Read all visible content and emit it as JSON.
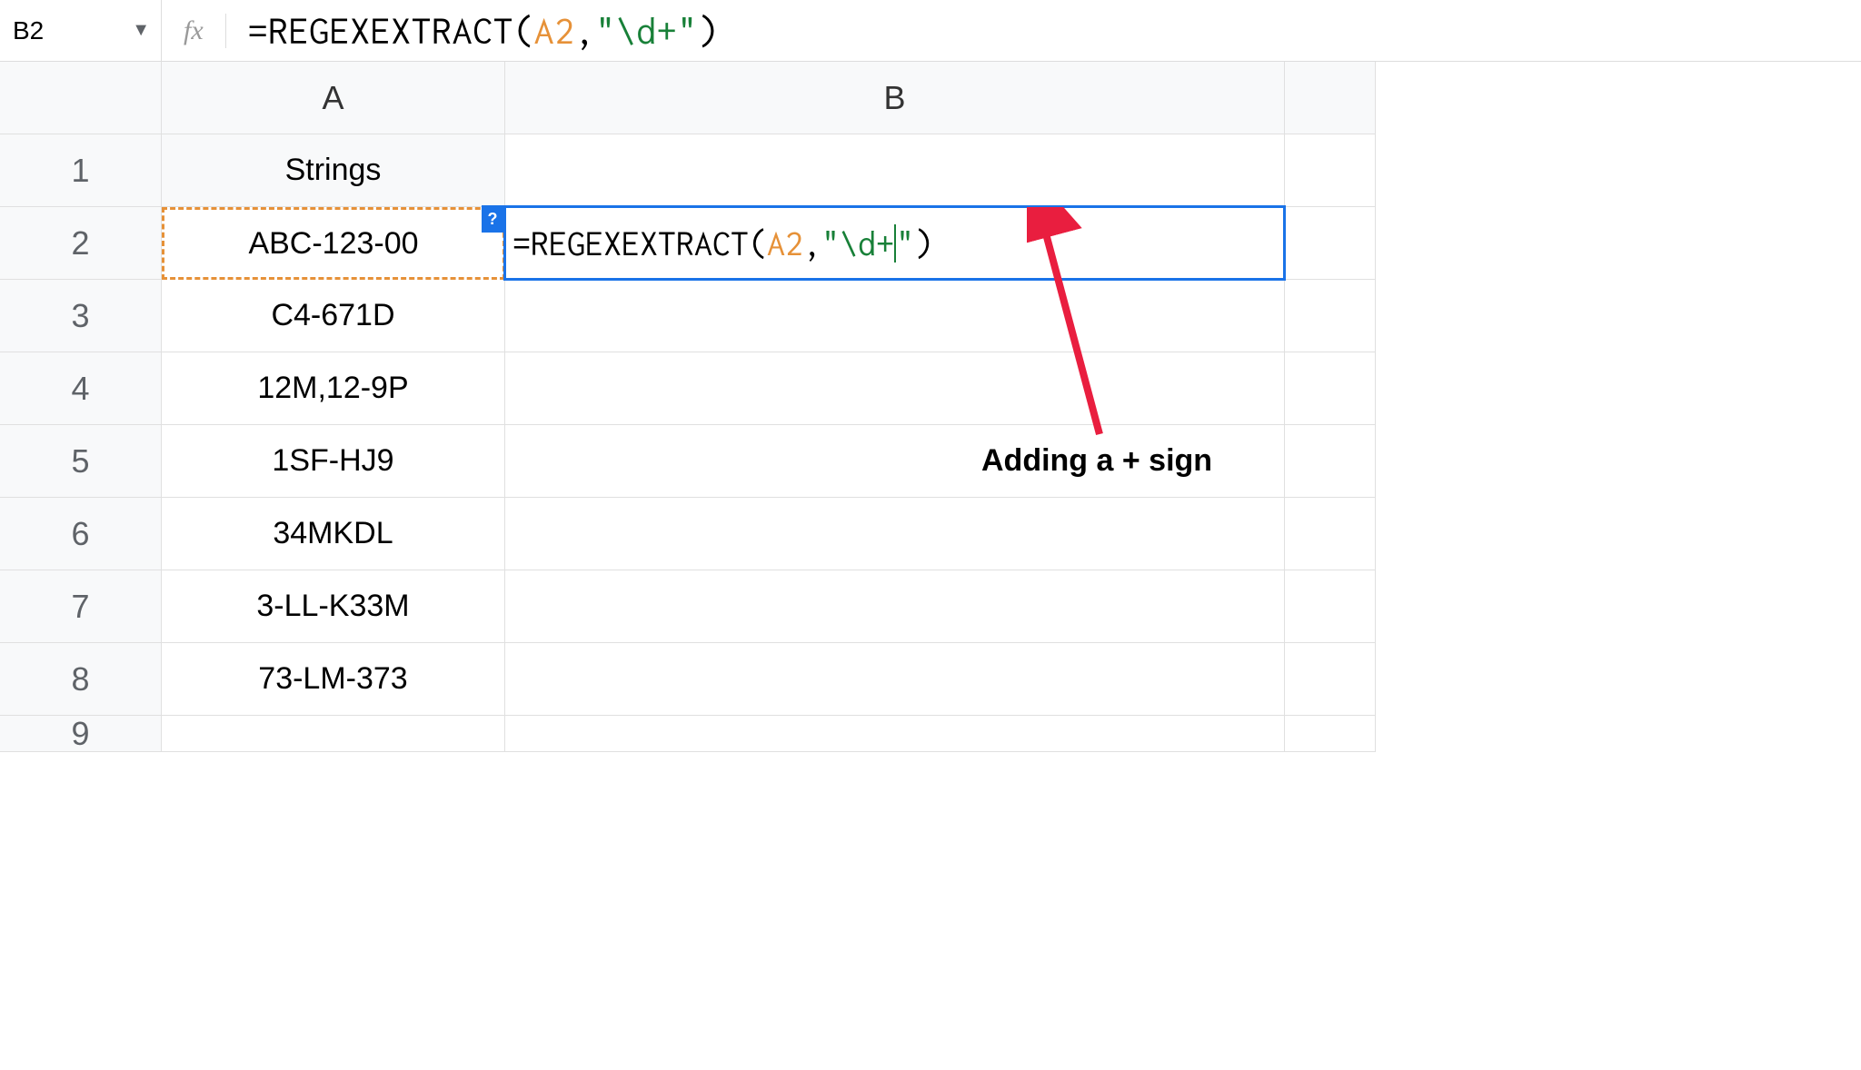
{
  "name_box": "B2",
  "fx_label": "fx",
  "formula": {
    "prefix": "=REGEXEXTRACT",
    "paren_open": "(",
    "ref": "A2",
    "comma": ",",
    "quote1": "\"",
    "regex_body": "\\d+",
    "quote2": "\"",
    "paren_close": ")"
  },
  "columns": [
    "A",
    "B"
  ],
  "rows": [
    "1",
    "2",
    "3",
    "4",
    "5",
    "6",
    "7",
    "8",
    "9"
  ],
  "cells": {
    "A1": "Strings",
    "A2": "ABC-123-00",
    "A3": "C4-671D",
    "A4": "12M,12-9P",
    "A5": "1SF-HJ9",
    "A6": "34MKDL",
    "A7": "3-LL-K33M",
    "A8": "73-LM-373"
  },
  "help_badge": "?",
  "annotation": "Adding a + sign"
}
